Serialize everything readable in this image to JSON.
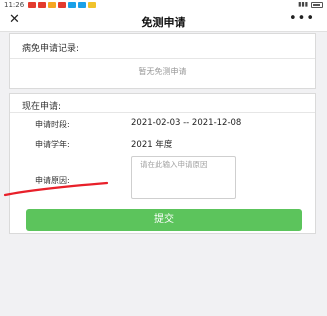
{
  "status_bar": {
    "time": "11:26",
    "app_colors": [
      "#e33b2e",
      "#e33b2e",
      "#f5a623",
      "#e33b2e",
      "#1aa0e8",
      "#1aa0e8",
      "#f0c22b"
    ],
    "signal": "▲ 📶"
  },
  "nav": {
    "title": "免测申请",
    "close_icon": "✕",
    "more_icon": "•••"
  },
  "history": {
    "title": "病免申请记录:",
    "empty_text": "暂无免测申请"
  },
  "current": {
    "title": "现在申请:",
    "period_label": "申请时段:",
    "period_value": "2021-02-03 -- 2021-12-08",
    "year_label": "申请学年:",
    "year_value": "2021 年度",
    "reason_label": "申请原因:",
    "reason_placeholder": "请在此输入申请原因",
    "submit_label": "提交"
  },
  "colors": {
    "accent": "#5cc45c",
    "annotation": "#e8202a"
  }
}
